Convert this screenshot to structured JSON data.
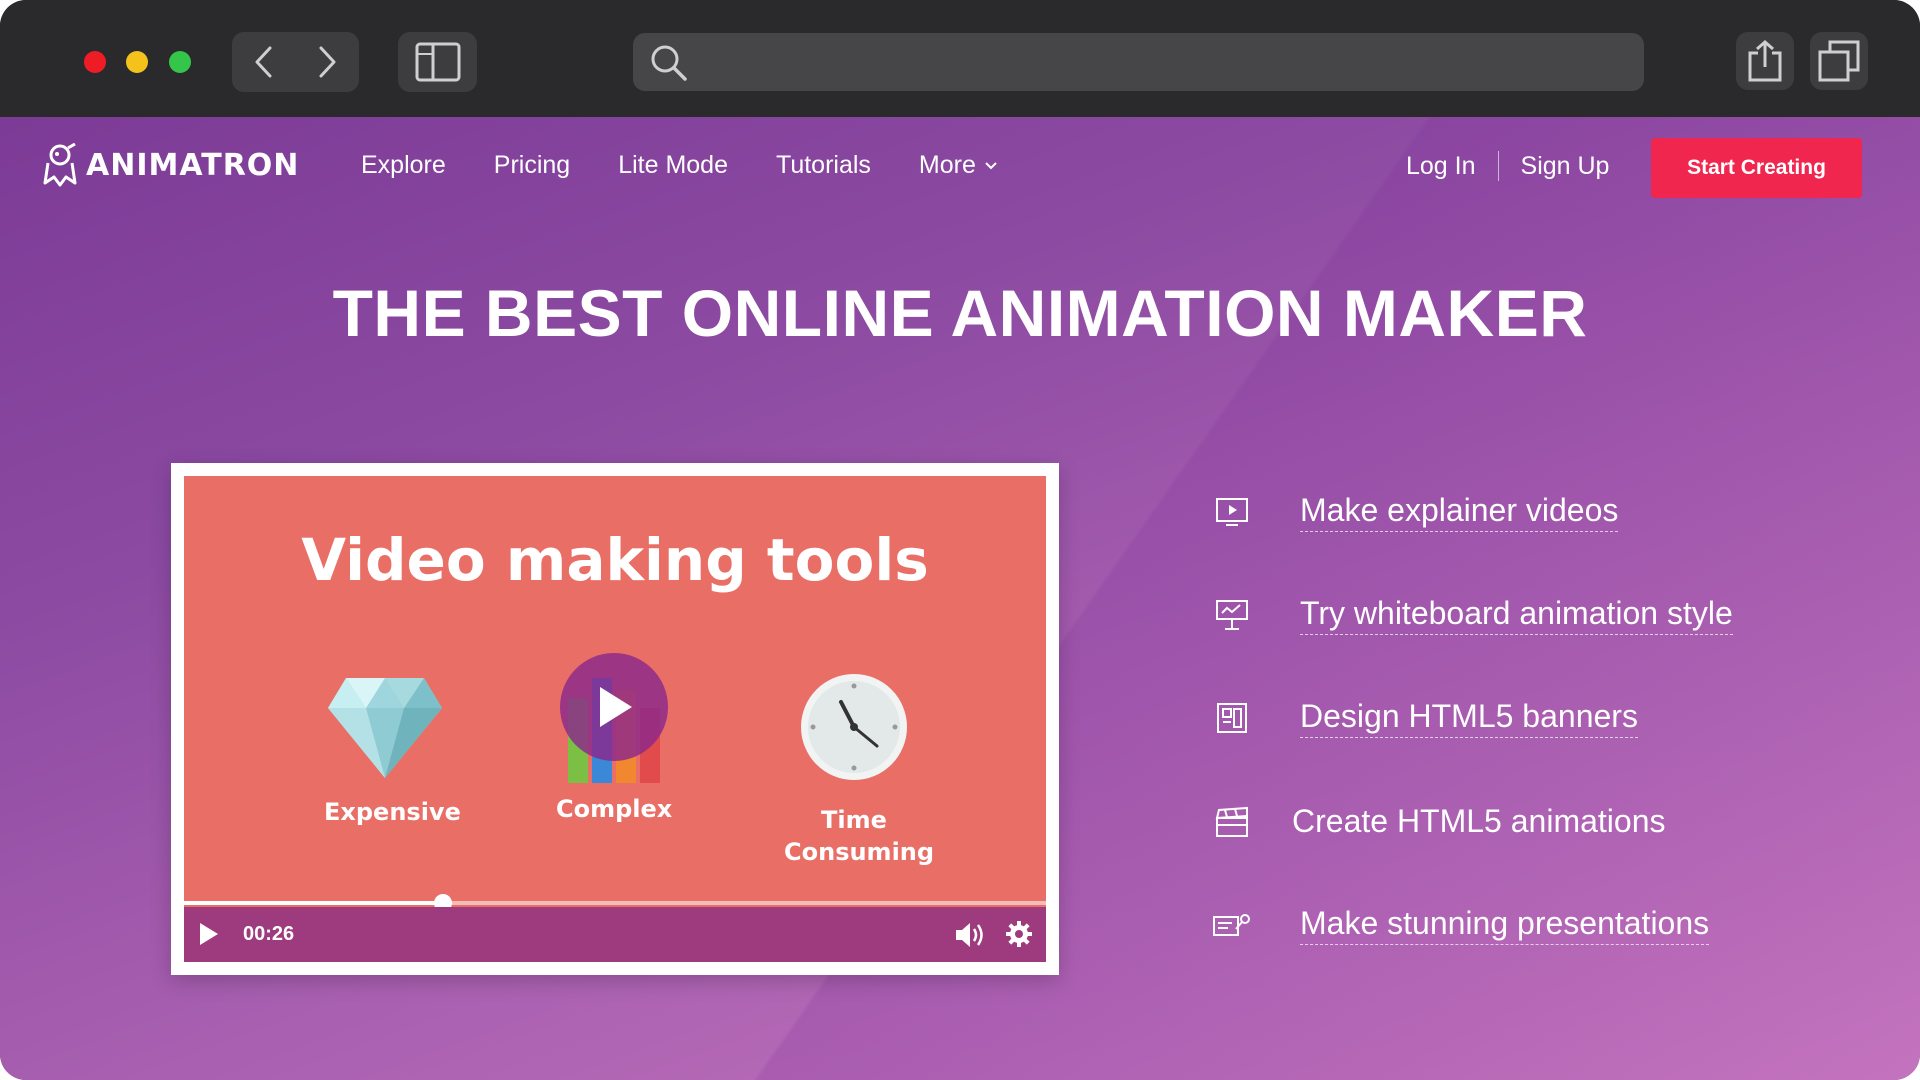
{
  "browser": {
    "address_placeholder": "",
    "icons": [
      "back-icon",
      "forward-icon",
      "sidebar-icon",
      "search-icon",
      "share-icon",
      "tabs-icon"
    ]
  },
  "brand": {
    "name": "ANIMATRON",
    "accent": "#f0264f",
    "background": "#8c4aa2"
  },
  "nav": {
    "items": [
      {
        "label": "Explore"
      },
      {
        "label": "Pricing"
      },
      {
        "label": "Lite Mode"
      },
      {
        "label": "Tutorials"
      },
      {
        "label": "More"
      }
    ],
    "login": "Log In",
    "signup": "Sign Up",
    "cta": "Start Creating"
  },
  "hero": {
    "title": "THE BEST ONLINE ANIMATION MAKER"
  },
  "video": {
    "title": "Video making tools",
    "items": [
      {
        "label": "Expensive",
        "icon": "diamond-icon"
      },
      {
        "label": "Complex",
        "icon": "bar-chart-icon"
      },
      {
        "label_line1": "Time",
        "label_line2": "Consuming",
        "icon": "clock-icon"
      }
    ],
    "time": "00:26",
    "progress": 0.3
  },
  "features": [
    {
      "label": "Make explainer videos",
      "icon": "video-icon",
      "linked": true
    },
    {
      "label": "Try whiteboard animation style",
      "icon": "whiteboard-icon",
      "linked": true
    },
    {
      "label": "Design HTML5 banners",
      "icon": "banner-icon",
      "linked": true
    },
    {
      "label": "Create HTML5 animations",
      "icon": "clapperboard-icon",
      "linked": false
    },
    {
      "label": "Make stunning presentations",
      "icon": "presentation-icon",
      "linked": true
    }
  ]
}
